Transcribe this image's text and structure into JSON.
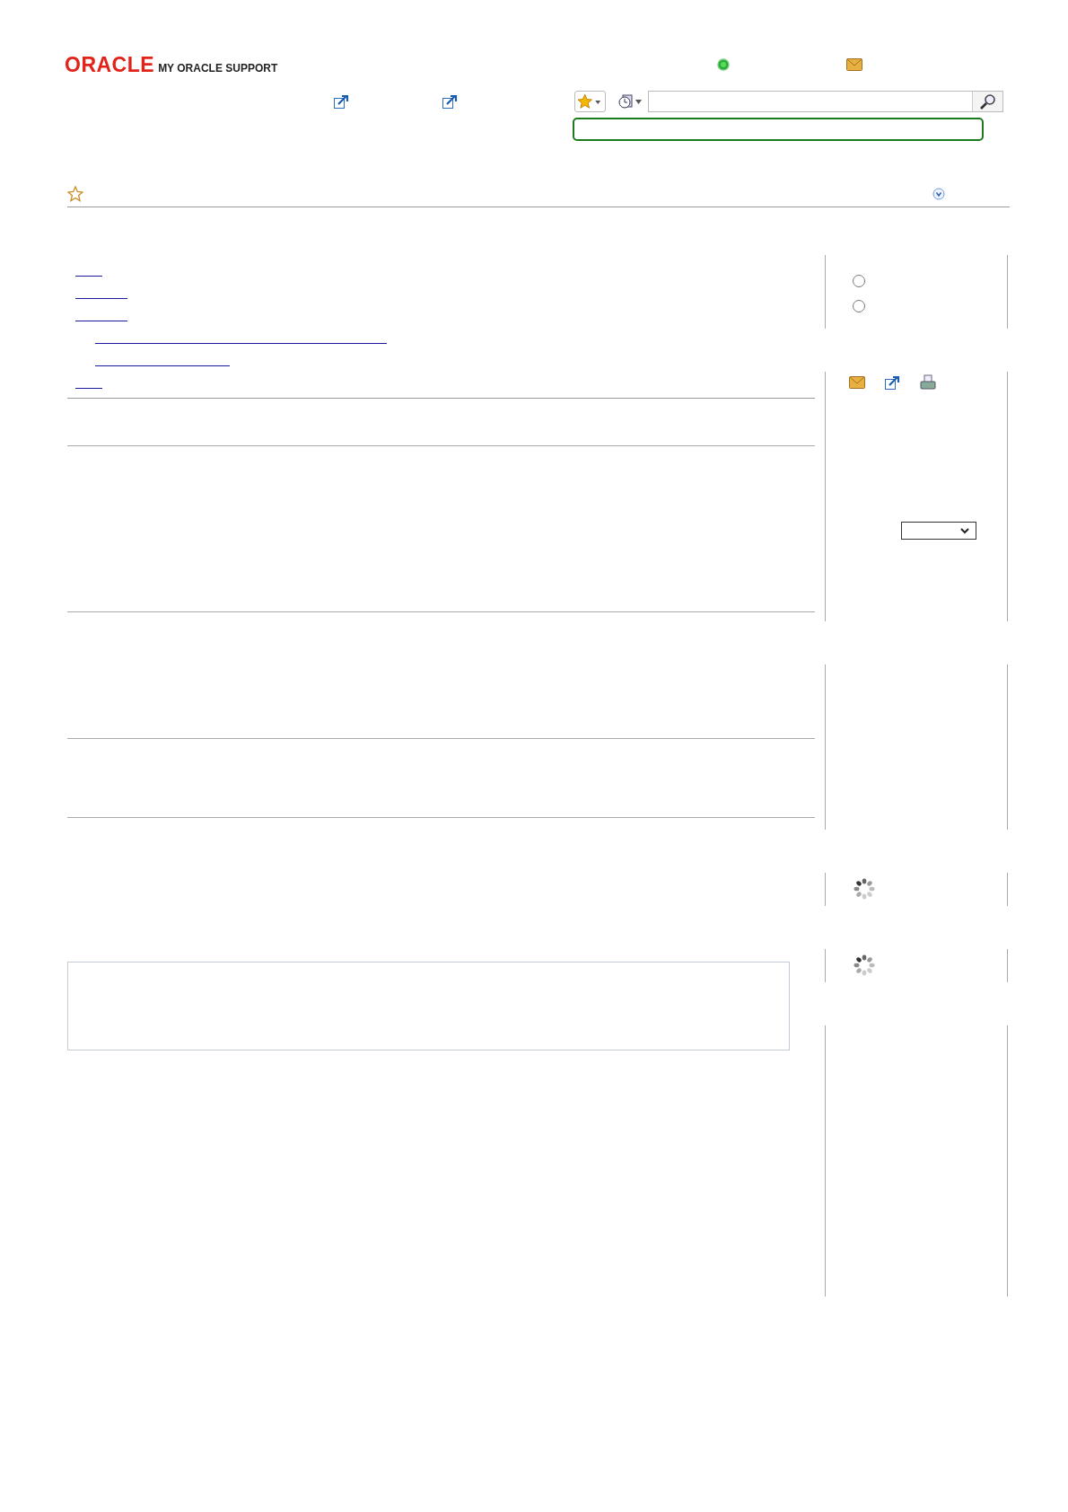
{
  "header": {
    "logo": "ORACLE",
    "product": "MY ORACLE SUPPORT"
  },
  "options": [
    {
      "selected": false
    },
    {
      "selected": false
    }
  ]
}
